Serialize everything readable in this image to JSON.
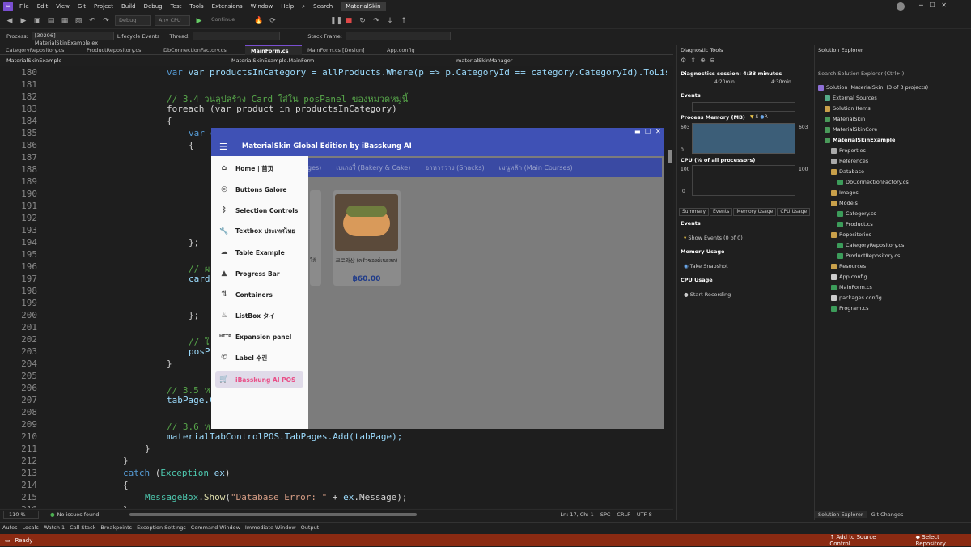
{
  "menu": {
    "items": [
      "File",
      "Edit",
      "View",
      "Git",
      "Project",
      "Build",
      "Debug",
      "Test",
      "Tools",
      "Extensions",
      "Window",
      "Help"
    ],
    "search": "Search",
    "solution": "MaterialSkin"
  },
  "toolbar": {
    "config": "Debug",
    "cpu": "Any CPU",
    "continue": "Continue"
  },
  "procbar": {
    "process_label": "Process:",
    "process": "[30296] MaterialSkinExample.ex",
    "lifecycle": "Lifecycle Events",
    "thread_label": "Thread:",
    "stack_label": "Stack Frame:"
  },
  "tabs": [
    "CategoryRepository.cs",
    "ProductRepository.cs",
    "DbConnectionFactory.cs",
    "MainForm.cs",
    "MainForm.cs [Design]",
    "App.config"
  ],
  "active_tab": 3,
  "navbar": {
    "project": "MaterialSkinExample",
    "cls": "MaterialSkinExample.MainForm",
    "member": "materialSkinManager"
  },
  "code": {
    "line_numbers": [
      "180",
      "181",
      "182",
      "183",
      "184",
      "185",
      "186",
      "187",
      "188",
      "189",
      "190",
      "191",
      "192",
      "193",
      "194",
      "195",
      "196",
      "197",
      "198",
      "199",
      "200",
      "201",
      "202",
      "203",
      "204",
      "205",
      "206",
      "207",
      "208",
      "209",
      "210",
      "211",
      "212",
      "213",
      "214",
      "215",
      "216"
    ],
    "line180": "var productsInCategory = allProducts.Where(p => p.CategoryId == category.CategoryId).ToList();",
    "line182": "// 3.4 วนลูปสร้าง Card ใส่ใน posPanel ของหมวดหมู่นี้",
    "line183": "foreach (var product in productsInCategory)",
    "line184": "{",
    "line185": "var c",
    "line186": "{",
    "line194": "};",
    "line196": "// ผ",
    "line197": "card",
    "line200": "};",
    "line202": "// ใ",
    "line203": "posP",
    "line204": "}",
    "line206": "// 3.5 ห",
    "line207": "tabPage.C",
    "line209": "// 3.6 ห",
    "line210": "materialTabControlPOS.TabPages.Add(tabPage);",
    "line211": "}",
    "line212": "}",
    "line213": "catch (Exception ex)",
    "line214": "{",
    "line215": "MessageBox.Show(\"Database Error: \" + ex.Message);",
    "line216": "}"
  },
  "edstatus": {
    "zoom": "110 %",
    "issues": "No issues found",
    "pos": "Ln: 17, Ch: 1",
    "spc": "SPC",
    "crlf": "CRLF",
    "enc": "UTF-8"
  },
  "debug_tabs": [
    "Autos",
    "Locals",
    "Watch 1",
    "Call Stack",
    "Breakpoints",
    "Exception Settings",
    "Command Window",
    "Immediate Window",
    "Output"
  ],
  "status": {
    "ready": "Ready",
    "source": "Add to Source Control",
    "repo": "Select Repository"
  },
  "diag": {
    "title": "Diagnostic Tools",
    "session": "Diagnostics session: 4:33 minutes",
    "t1": "4:20min",
    "t2": "4:30min",
    "events": "Events",
    "memory": "Process Memory (MB)",
    "legend1": "S",
    "legend2": "P.",
    "mem_hi": "603",
    "mem_lo": "0",
    "cpu": "CPU (% of all processors)",
    "cpu_hi": "100",
    "cpu_lo": "0",
    "tabs": [
      "Summary",
      "Events",
      "Memory Usage",
      "CPU Usage"
    ],
    "s_events": "Events",
    "show_events": "Show Events (0 of 0)",
    "s_mem": "Memory Usage",
    "snapshot": "Take Snapshot",
    "s_cpu": "CPU Usage",
    "record": "Start Recording"
  },
  "sol": {
    "title": "Solution Explorer",
    "search": "Search Solution Explorer (Ctrl+;)",
    "items": [
      "Solution 'MaterialSkin' (3 of 3 projects)",
      "External Sources",
      "Solution Items",
      "MaterialSkin",
      "MaterialSkinCore",
      "MaterialSkinExample",
      "Properties",
      "References",
      "Database",
      "DbConnectionFactory.cs",
      "Images",
      "Models",
      "Category.cs",
      "Product.cs",
      "Repositories",
      "CategoryRepository.cs",
      "ProductRepository.cs",
      "Resources",
      "App.config",
      "MainForm.cs",
      "packages.config",
      "Program.cs"
    ],
    "tab1": "Solution Explorer",
    "tab2": "Git Changes"
  },
  "app": {
    "title": "MaterialSkin Global Edition by iBasskung AI",
    "tabs": [
      "ges)",
      "เบเกอรี่ (Bakery & Cake)",
      "อาหารว่าง (Snacks)",
      "เมนูหลัก (Main Courses)"
    ],
    "drawer": [
      "Home | 首页",
      "Buttons Galore",
      "Selection Controls",
      "Textbox ประเทศไทย",
      "Table Example",
      "Progress Bar",
      "Containers",
      "ListBox タイ",
      "Expansion panel",
      "Label 수린",
      "iBasskung AI POS"
    ],
    "card_name": "크로와상 (ครัวซองต์เนยสด)",
    "card_price": "฿60.00",
    "card_cut": "ใส้"
  },
  "colors": {
    "accent": "#3f51b5",
    "selected": "#e94e87",
    "status": "#8a2a12"
  }
}
